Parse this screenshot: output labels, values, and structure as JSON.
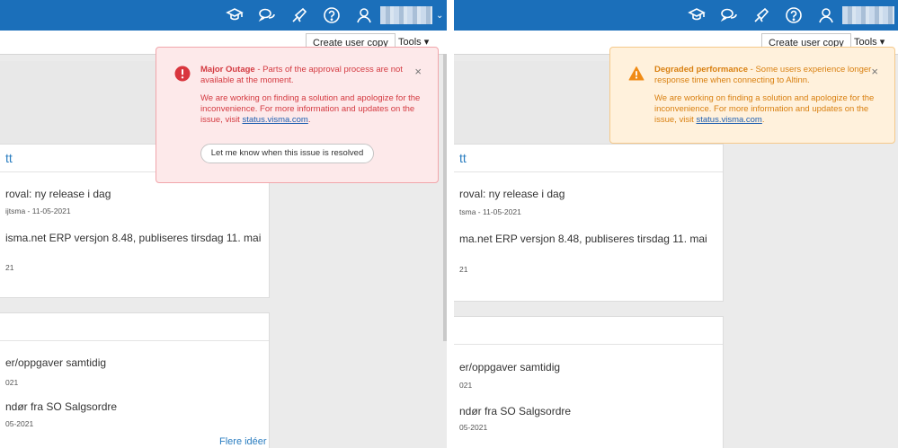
{
  "toolbar": {
    "create_user_copy": "Create user copy",
    "tools": "Tools",
    "tools_caret": "▾"
  },
  "icons": [
    "graduation-cap-icon",
    "chat-bubbles-icon",
    "megaphone-icon",
    "help-icon",
    "user-icon"
  ],
  "colors": {
    "topbar": "#1b6fba",
    "outage_text": "#d43a41",
    "outage_bg": "#fde9ea",
    "degraded_text": "#d98011",
    "degraded_bg": "#fff1dc",
    "link": "#2a7dc0"
  },
  "feed": {
    "card1_header": "tt",
    "news1_title": "roval: ny release i dag",
    "news2_title": "isma.net ERP versjon 8.48, publiseres tirsdag 11. mai",
    "news2_meta": "21",
    "ideas1_title": "er/oppgaver samtidig",
    "ideas1_meta": "021",
    "ideas2_title": "ndør fra SO Salgsordre",
    "ideas2_meta": "05-2021",
    "more_ideas": "Flere idéer"
  },
  "left": {
    "news1_meta": "ijtsma - 11-05-2021"
  },
  "right": {
    "news1_meta": "tsma - 11-05-2021",
    "news2_title": "ma.net ERP versjon 8.48, publiseres tirsdag 11. mai"
  },
  "outage": {
    "title": "Major Outage",
    "message": " - Parts of the approval process are not available at the moment.",
    "body": "We are working on finding a solution and apologize for the inconvenience. For more information and updates on the issue, visit ",
    "link": "status.visma.com",
    "button": "Let me know when this issue is resolved",
    "close": "×"
  },
  "degraded": {
    "title": "Degraded performance",
    "message": " - Some users experience longer response time when connecting to Altinn.",
    "body": "We are working on finding a solution and apologize for the inconvenience. For more information and updates on the issue, visit ",
    "link": "status.visma.com",
    "close": "×"
  }
}
